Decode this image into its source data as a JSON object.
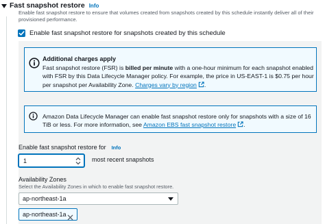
{
  "section": {
    "title": "Fast snapshot restore",
    "info": "Info",
    "description": "Enable fast snapshot restore to ensure that volumes created from snapshots created by this schedule instantly deliver all of their provisioned performance."
  },
  "enable_checkbox": {
    "checked": true,
    "label": "Enable fast snapshot restore for snapshots created by this schedule"
  },
  "charges_alert": {
    "title": "Additional charges apply",
    "text_before_bold": "Fast snapshot restore (FSR) is ",
    "bold_text": "billed per minute",
    "text_after_bold": " with a one-hour minimum for each snapshot enabled with FSR by this Data Lifecycle Manager policy. For example, the price in US-EAST-1 is $0.75 per hour per snapshot per Availability Zone. ",
    "link": "Charges vary by region",
    "text_end": "."
  },
  "size_alert": {
    "text": "Amazon Data Lifecycle Manager can enable fast snapshot restore only for snapshots with a size of 16 TiB or less. For more information, see ",
    "link": "Amazon EBS fast snapshot restore",
    "text_end": "."
  },
  "fsr_count": {
    "label": "Enable fast snapshot restore for",
    "info": "Info",
    "value": "1",
    "suffix": "most recent snapshots"
  },
  "availability_zones": {
    "label": "Availability Zones",
    "description": "Select the Availability Zones in which to enable fast snapshot restore.",
    "selected": "ap-northeast-1a",
    "tokens": [
      "ap-northeast-1a"
    ]
  },
  "colors": {
    "accent": "#0073bb",
    "alert_bg": "#f1faff",
    "panel_bg": "#f2f3f3"
  }
}
